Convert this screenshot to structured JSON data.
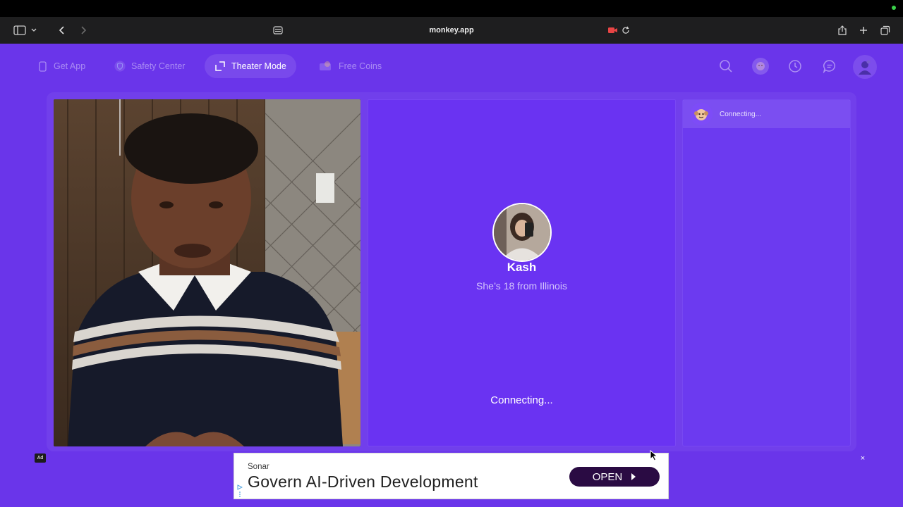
{
  "browser": {
    "url": "monkey.app"
  },
  "nav": {
    "get_app": "Get App",
    "safety_center": "Safety Center",
    "theater_mode": "Theater Mode",
    "free_coins": "Free Coins"
  },
  "header_icons": [
    "search-icon",
    "monkey-avatar-icon",
    "history-icon",
    "chat-bubble-icon",
    "profile-avatar"
  ],
  "partner": {
    "name": "Kash",
    "subtitle": "She’s 18 from Illinois",
    "status": "Connecting..."
  },
  "chat": {
    "status": "Connecting..."
  },
  "ad": {
    "badge": "Ad",
    "brand": "Sonar",
    "headline": "Govern AI-Driven Development",
    "cta": "OPEN",
    "close": "×"
  },
  "colors": {
    "background": "#6a35ea",
    "panel": "#6a33f2",
    "cta": "#2a0b43"
  }
}
